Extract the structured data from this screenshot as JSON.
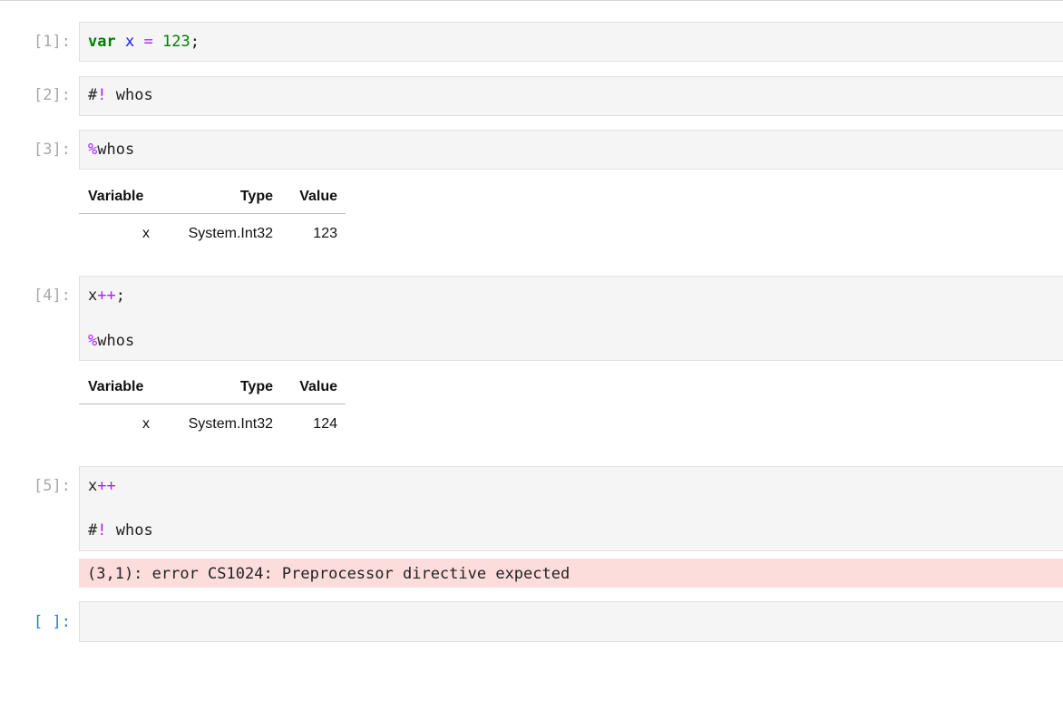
{
  "cells": [
    {
      "prompt": "[1]:",
      "lines": [
        [
          {
            "t": "var",
            "c": "kw"
          },
          {
            "t": " "
          },
          {
            "t": "x",
            "c": "var"
          },
          {
            "t": " "
          },
          {
            "t": "=",
            "c": "op"
          },
          {
            "t": " "
          },
          {
            "t": "123",
            "c": "num"
          },
          {
            "t": ";"
          }
        ]
      ]
    },
    {
      "prompt": "[2]:",
      "lines": [
        [
          {
            "t": "#"
          },
          {
            "t": "!",
            "c": "op"
          },
          {
            "t": " whos"
          }
        ]
      ]
    },
    {
      "prompt": "[3]:",
      "lines": [
        [
          {
            "t": "%",
            "c": "magic"
          },
          {
            "t": "whos"
          }
        ]
      ],
      "output": {
        "headers": [
          "Variable",
          "Type",
          "Value"
        ],
        "rows": [
          [
            "x",
            "System.Int32",
            "123"
          ]
        ]
      }
    },
    {
      "prompt": "[4]:",
      "lines": [
        [
          {
            "t": "x"
          },
          {
            "t": "++",
            "c": "op"
          },
          {
            "t": ";"
          }
        ],
        [],
        [
          {
            "t": "%",
            "c": "magic"
          },
          {
            "t": "whos"
          }
        ]
      ],
      "output": {
        "headers": [
          "Variable",
          "Type",
          "Value"
        ],
        "rows": [
          [
            "x",
            "System.Int32",
            "124"
          ]
        ]
      }
    },
    {
      "prompt": "[5]:",
      "lines": [
        [
          {
            "t": "x"
          },
          {
            "t": "++",
            "c": "op"
          }
        ],
        [],
        [
          {
            "t": "#"
          },
          {
            "t": "!",
            "c": "op"
          },
          {
            "t": " whos"
          }
        ]
      ],
      "error": "(3,1): error CS1024: Preprocessor directive expected"
    },
    {
      "prompt": "[ ]:",
      "lines": []
    }
  ],
  "colors": {
    "keyword": "#008000",
    "operator": "#aa22ff",
    "number": "#008000",
    "variable": "#1a1aff",
    "error_bg": "#fddcdc",
    "prompt": "#a8a8a8",
    "empty_prompt": "#3178c6"
  }
}
